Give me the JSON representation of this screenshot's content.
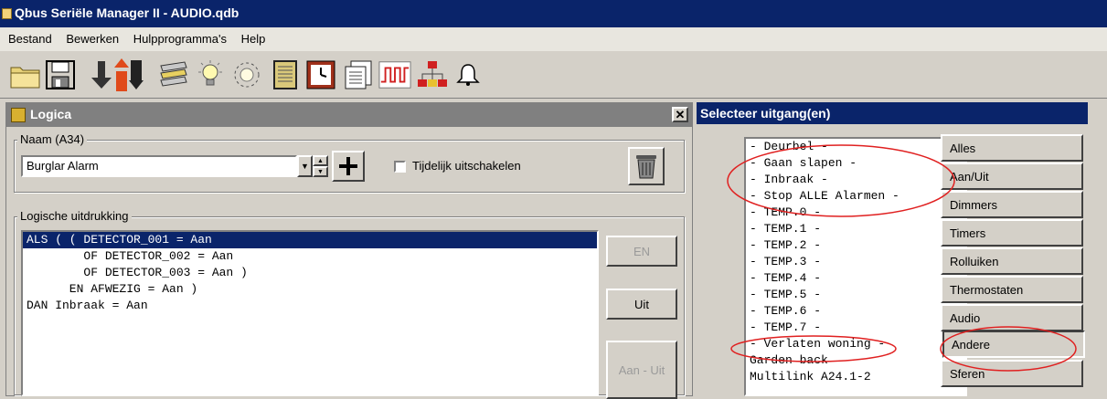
{
  "window": {
    "title": "Qbus Seriële Manager II - AUDIO.qdb"
  },
  "menu": [
    "Bestand",
    "Bewerken",
    "Hulpprogramma's",
    "Help"
  ],
  "toolbar": {
    "icons": [
      "folder-open-icon",
      "save-icon",
      "download-arrow-icon",
      "upload-arrow-icon",
      "modules-icon",
      "bulb-icon",
      "dimmer-icon",
      "display-module-icon",
      "clock-icon",
      "list-icon",
      "signal-icon",
      "network-icon",
      "bell-icon"
    ]
  },
  "logica": {
    "title": "Logica",
    "name_label": "Naam (A34)",
    "name_value": "Burglar Alarm",
    "disable_label": "Tijdelijk uitschakelen",
    "expr_label": "Logische uitdrukking",
    "expr_lines": [
      "ALS ( ( DETECTOR_001 = Aan",
      "        OF DETECTOR_002 = Aan",
      "        OF DETECTOR_003 = Aan )",
      "      EN AFWEZIG = Aan )",
      "DAN Inbraak = Aan"
    ],
    "selected_line": 0,
    "buttons": {
      "en": "EN",
      "uit": "Uit",
      "aan_uit": "Aan - Uit"
    }
  },
  "selector": {
    "title": "Selecteer uitgang(en)",
    "items": [
      "- Deurbel -",
      "- Gaan slapen -",
      "- Inbraak -",
      "- Stop ALLE Alarmen -",
      "- TEMP.0 -",
      "- TEMP.1 -",
      "- TEMP.2 -",
      "- TEMP.3 -",
      "- TEMP.4 -",
      "- TEMP.5 -",
      "- TEMP.6 -",
      "- TEMP.7 -",
      "- Verlaten woning -",
      "Garden back",
      "Multilink A24.1-2"
    ],
    "categories": [
      "Alles",
      "Aan/Uit",
      "Dimmers",
      "Timers",
      "Rolluiken",
      "Thermostaten",
      "Audio",
      "Andere",
      "Sferen"
    ],
    "active_category": "Andere"
  },
  "annotation_color": "#e02020"
}
